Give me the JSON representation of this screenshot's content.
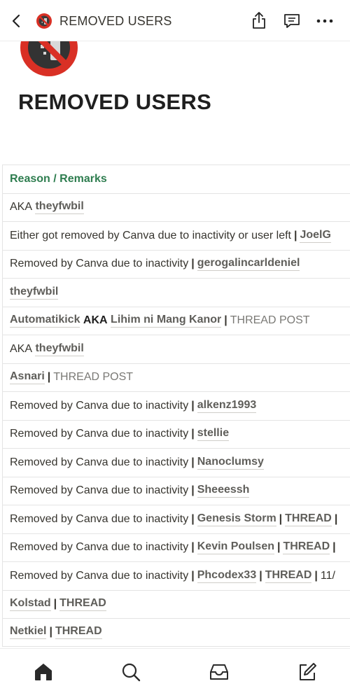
{
  "topbar": {
    "title": "REMOVED USERS",
    "icons": [
      "back-chevron-icon",
      "no-littering-emoji-icon",
      "share-icon",
      "comment-icon",
      "more-icon"
    ]
  },
  "page": {
    "icon": "no-littering-emoji",
    "title": "REMOVED USERS"
  },
  "table": {
    "header": "Reason / Remarks",
    "rows": [
      {
        "aka": "AKA",
        "user": "theyfwbil"
      },
      {
        "text": "Either got removed by Canva due to inactivity or user left",
        "sep": "|",
        "user": "JoelG"
      },
      {
        "text": "Removed by Canva due to inactivity",
        "sep": "|",
        "user": "gerogalincarldeniel"
      },
      {
        "user": "theyfwbil"
      },
      {
        "user": "Automatikick",
        "aka": "AKA",
        "user2": "Lihim ni Mang Kanor",
        "sep": "|",
        "tag": "THREAD POST"
      },
      {
        "aka": "AKA",
        "user": "theyfwbil"
      },
      {
        "user": "Asnari",
        "sep": "|",
        "tag": "THREAD POST"
      },
      {
        "text": "Removed by Canva due to inactivity",
        "sep": "|",
        "user": "alkenz1993"
      },
      {
        "text": "Removed by Canva due to inactivity",
        "sep": "|",
        "user": "stellie"
      },
      {
        "text": "Removed by Canva due to inactivity",
        "sep": "|",
        "user": "Nanoclumsy"
      },
      {
        "text": "Removed by Canva due to inactivity",
        "sep": "|",
        "user": "Sheeessh"
      },
      {
        "text": "Removed by Canva due to inactivity",
        "sep": "|",
        "user": "Genesis Storm",
        "sep2": "|",
        "tag": "THREAD",
        "sep3": "|"
      },
      {
        "text": "Removed by Canva due to inactivity",
        "sep": "|",
        "user": "Kevin Poulsen",
        "sep2": "|",
        "tag": "THREAD",
        "sep3": "|"
      },
      {
        "text": "Removed by Canva due to inactivity",
        "sep": "|",
        "user": "Phcodex33",
        "sep2": "|",
        "tag": "THREAD",
        "sep3": "|",
        "tail": "11/"
      },
      {
        "user": "Kolstad",
        "sep": "|",
        "tag": "THREAD"
      },
      {
        "user": "Netkiel",
        "sep": "|",
        "tag": "THREAD"
      }
    ]
  },
  "bottomnav": {
    "items": [
      "home-icon",
      "search-icon",
      "inbox-icon",
      "compose-icon"
    ]
  },
  "colors": {
    "header_green": "#2e7d4f",
    "text": "#37352f",
    "link_gray": "#5f5e5a",
    "border": "#e4e4e4",
    "emoji_red": "#d93025"
  }
}
